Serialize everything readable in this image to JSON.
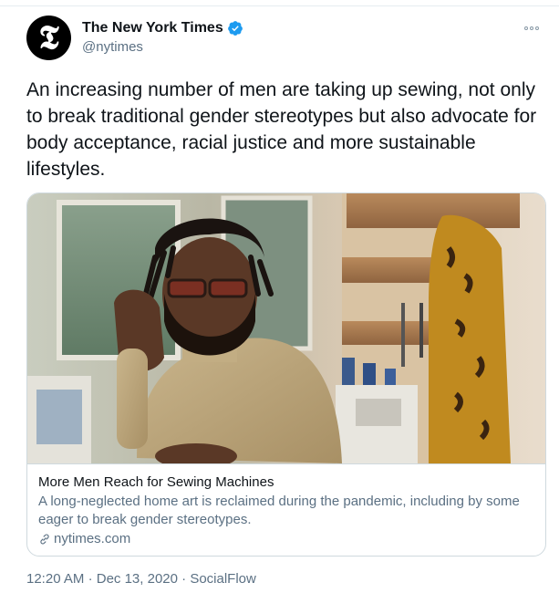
{
  "author": {
    "display_name": "The New York Times",
    "handle": "@nytimes",
    "avatar_glyph": "𝕿",
    "verified_icon": "verified-badge-icon",
    "verified_color": "#1d9bf0"
  },
  "tweet": {
    "text": "An increasing number of men are taking up sewing, not only to break traditional gender stereotypes but also advocate for body acceptance, racial justice and more sustainable lifestyles."
  },
  "card": {
    "image_icon": "photo",
    "title": "More Men Reach for Sewing Machines",
    "description": "A long-neglected home art is reclaimed during the pandemic, including by some eager to break gender stereotypes.",
    "domain_icon": "link-icon",
    "domain": "nytimes.com"
  },
  "meta": {
    "time": "12:20 AM",
    "separator1": "·",
    "date": "Dec 13, 2020",
    "separator2": "·",
    "source": "SocialFlow"
  },
  "menu": {
    "icon": "more-icon"
  },
  "colors": {
    "text_primary": "#0f1419",
    "text_secondary": "#5b7083",
    "border": "#cfd9de"
  }
}
